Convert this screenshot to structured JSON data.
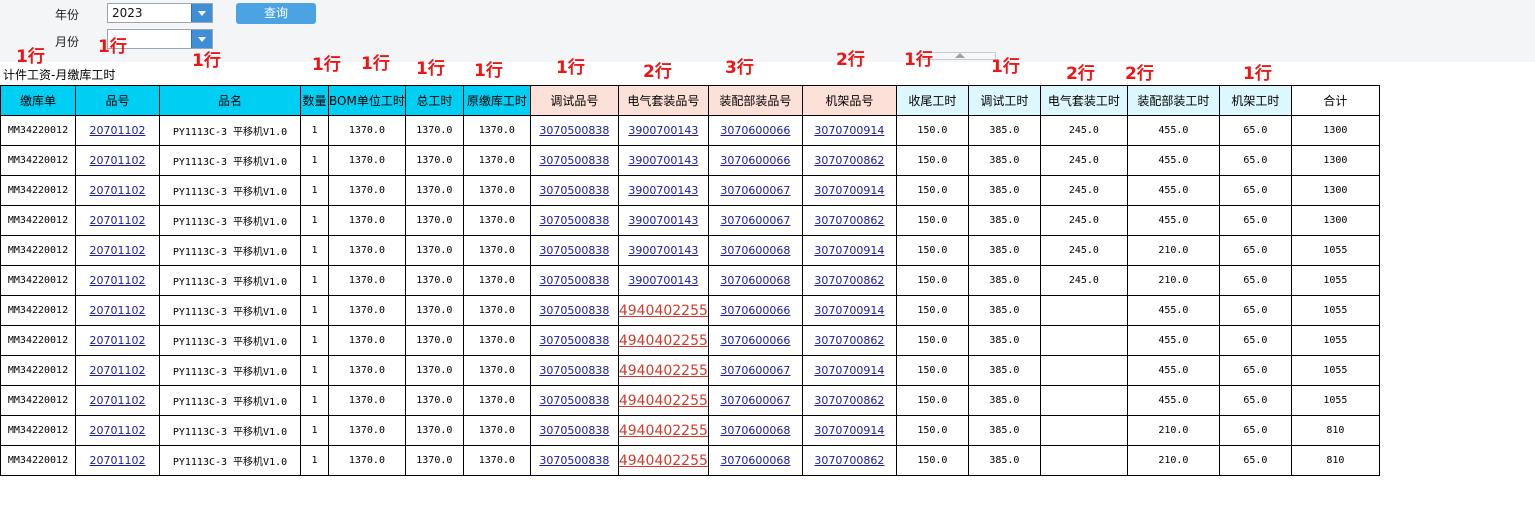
{
  "filters": {
    "year_label": "年份",
    "year_value": "2023",
    "month_label": "月份",
    "month_value": "",
    "query_button": "查询"
  },
  "report_title": "计件工资-月缴库工时",
  "annotations": [
    "1行",
    "1行",
    "1行",
    "1行",
    "1行",
    "1行",
    "1行",
    "1行",
    "2行",
    "3行",
    "2行",
    "1行",
    "1行",
    "2行",
    "2行",
    "1行"
  ],
  "columns": [
    "缴库单",
    "品号",
    "品名",
    "数量",
    "BOM单位工时",
    "总工时",
    "原缴库工时",
    "调试品号",
    "电气套装品号",
    "装配部装品号",
    "机架品号",
    "收尾工时",
    "调试工时",
    "电气套装工时",
    "装配部装工时",
    "机架工时",
    "合计"
  ],
  "rows": [
    {
      "order": "MM34220012",
      "item": "20701102",
      "name": "PY1113C-3 平移机V1.0",
      "qty": "1",
      "bom_hours": "1370.0",
      "total_hours": "1370.0",
      "orig_hours": "1370.0",
      "debug_item": "3070500838",
      "elec_item": "3900700143",
      "assembly_item": "3070600066",
      "frame_item": "3070700914",
      "finish_hours": "150.0",
      "debug_hours": "385.0",
      "elec_hours": "245.0",
      "assembly_hours": "455.0",
      "frame_hours": "65.0",
      "sum": "1300"
    },
    {
      "order": "MM34220012",
      "item": "20701102",
      "name": "PY1113C-3 平移机V1.0",
      "qty": "1",
      "bom_hours": "1370.0",
      "total_hours": "1370.0",
      "orig_hours": "1370.0",
      "debug_item": "3070500838",
      "elec_item": "3900700143",
      "assembly_item": "3070600066",
      "frame_item": "3070700862",
      "finish_hours": "150.0",
      "debug_hours": "385.0",
      "elec_hours": "245.0",
      "assembly_hours": "455.0",
      "frame_hours": "65.0",
      "sum": "1300"
    },
    {
      "order": "MM34220012",
      "item": "20701102",
      "name": "PY1113C-3 平移机V1.0",
      "qty": "1",
      "bom_hours": "1370.0",
      "total_hours": "1370.0",
      "orig_hours": "1370.0",
      "debug_item": "3070500838",
      "elec_item": "3900700143",
      "assembly_item": "3070600067",
      "frame_item": "3070700914",
      "finish_hours": "150.0",
      "debug_hours": "385.0",
      "elec_hours": "245.0",
      "assembly_hours": "455.0",
      "frame_hours": "65.0",
      "sum": "1300"
    },
    {
      "order": "MM34220012",
      "item": "20701102",
      "name": "PY1113C-3 平移机V1.0",
      "qty": "1",
      "bom_hours": "1370.0",
      "total_hours": "1370.0",
      "orig_hours": "1370.0",
      "debug_item": "3070500838",
      "elec_item": "3900700143",
      "assembly_item": "3070600067",
      "frame_item": "3070700862",
      "finish_hours": "150.0",
      "debug_hours": "385.0",
      "elec_hours": "245.0",
      "assembly_hours": "455.0",
      "frame_hours": "65.0",
      "sum": "1300"
    },
    {
      "order": "MM34220012",
      "item": "20701102",
      "name": "PY1113C-3 平移机V1.0",
      "qty": "1",
      "bom_hours": "1370.0",
      "total_hours": "1370.0",
      "orig_hours": "1370.0",
      "debug_item": "3070500838",
      "elec_item": "3900700143",
      "assembly_item": "3070600068",
      "frame_item": "3070700914",
      "finish_hours": "150.0",
      "debug_hours": "385.0",
      "elec_hours": "245.0",
      "assembly_hours": "210.0",
      "frame_hours": "65.0",
      "sum": "1055"
    },
    {
      "order": "MM34220012",
      "item": "20701102",
      "name": "PY1113C-3 平移机V1.0",
      "qty": "1",
      "bom_hours": "1370.0",
      "total_hours": "1370.0",
      "orig_hours": "1370.0",
      "debug_item": "3070500838",
      "elec_item": "3900700143",
      "assembly_item": "3070600068",
      "frame_item": "3070700862",
      "finish_hours": "150.0",
      "debug_hours": "385.0",
      "elec_hours": "245.0",
      "assembly_hours": "210.0",
      "frame_hours": "65.0",
      "sum": "1055"
    },
    {
      "order": "MM34220012",
      "item": "20701102",
      "name": "PY1113C-3 平移机V1.0",
      "qty": "1",
      "bom_hours": "1370.0",
      "total_hours": "1370.0",
      "orig_hours": "1370.0",
      "debug_item": "3070500838",
      "elec_item": "4940402255",
      "assembly_item": "3070600066",
      "frame_item": "3070700914",
      "finish_hours": "150.0",
      "debug_hours": "385.0",
      "elec_hours": "",
      "assembly_hours": "455.0",
      "frame_hours": "65.0",
      "sum": "1055"
    },
    {
      "order": "MM34220012",
      "item": "20701102",
      "name": "PY1113C-3 平移机V1.0",
      "qty": "1",
      "bom_hours": "1370.0",
      "total_hours": "1370.0",
      "orig_hours": "1370.0",
      "debug_item": "3070500838",
      "elec_item": "4940402255",
      "assembly_item": "3070600066",
      "frame_item": "3070700862",
      "finish_hours": "150.0",
      "debug_hours": "385.0",
      "elec_hours": "",
      "assembly_hours": "455.0",
      "frame_hours": "65.0",
      "sum": "1055"
    },
    {
      "order": "MM34220012",
      "item": "20701102",
      "name": "PY1113C-3 平移机V1.0",
      "qty": "1",
      "bom_hours": "1370.0",
      "total_hours": "1370.0",
      "orig_hours": "1370.0",
      "debug_item": "3070500838",
      "elec_item": "4940402255",
      "assembly_item": "3070600067",
      "frame_item": "3070700914",
      "finish_hours": "150.0",
      "debug_hours": "385.0",
      "elec_hours": "",
      "assembly_hours": "455.0",
      "frame_hours": "65.0",
      "sum": "1055"
    },
    {
      "order": "MM34220012",
      "item": "20701102",
      "name": "PY1113C-3 平移机V1.0",
      "qty": "1",
      "bom_hours": "1370.0",
      "total_hours": "1370.0",
      "orig_hours": "1370.0",
      "debug_item": "3070500838",
      "elec_item": "4940402255",
      "assembly_item": "3070600067",
      "frame_item": "3070700862",
      "finish_hours": "150.0",
      "debug_hours": "385.0",
      "elec_hours": "",
      "assembly_hours": "455.0",
      "frame_hours": "65.0",
      "sum": "1055"
    },
    {
      "order": "MM34220012",
      "item": "20701102",
      "name": "PY1113C-3 平移机V1.0",
      "qty": "1",
      "bom_hours": "1370.0",
      "total_hours": "1370.0",
      "orig_hours": "1370.0",
      "debug_item": "3070500838",
      "elec_item": "4940402255",
      "assembly_item": "3070600068",
      "frame_item": "3070700914",
      "finish_hours": "150.0",
      "debug_hours": "385.0",
      "elec_hours": "",
      "assembly_hours": "210.0",
      "frame_hours": "65.0",
      "sum": "810"
    },
    {
      "order": "MM34220012",
      "item": "20701102",
      "name": "PY1113C-3 平移机V1.0",
      "qty": "1",
      "bom_hours": "1370.0",
      "total_hours": "1370.0",
      "orig_hours": "1370.0",
      "debug_item": "3070500838",
      "elec_item": "4940402255",
      "assembly_item": "3070600068",
      "frame_item": "3070700862",
      "finish_hours": "150.0",
      "debug_hours": "385.0",
      "elec_hours": "",
      "assembly_hours": "210.0",
      "frame_hours": "65.0",
      "sum": "810"
    }
  ],
  "colors": {
    "header_cyan": "#00cff4",
    "header_peach": "#fde1d8",
    "header_lightblue": "#dcf7fd",
    "annotation_red": "#f01414",
    "link_blue": "#1a1aa6",
    "link_red": "#d23b2c"
  },
  "icons": {
    "dropdown": "chevron-down-icon"
  }
}
